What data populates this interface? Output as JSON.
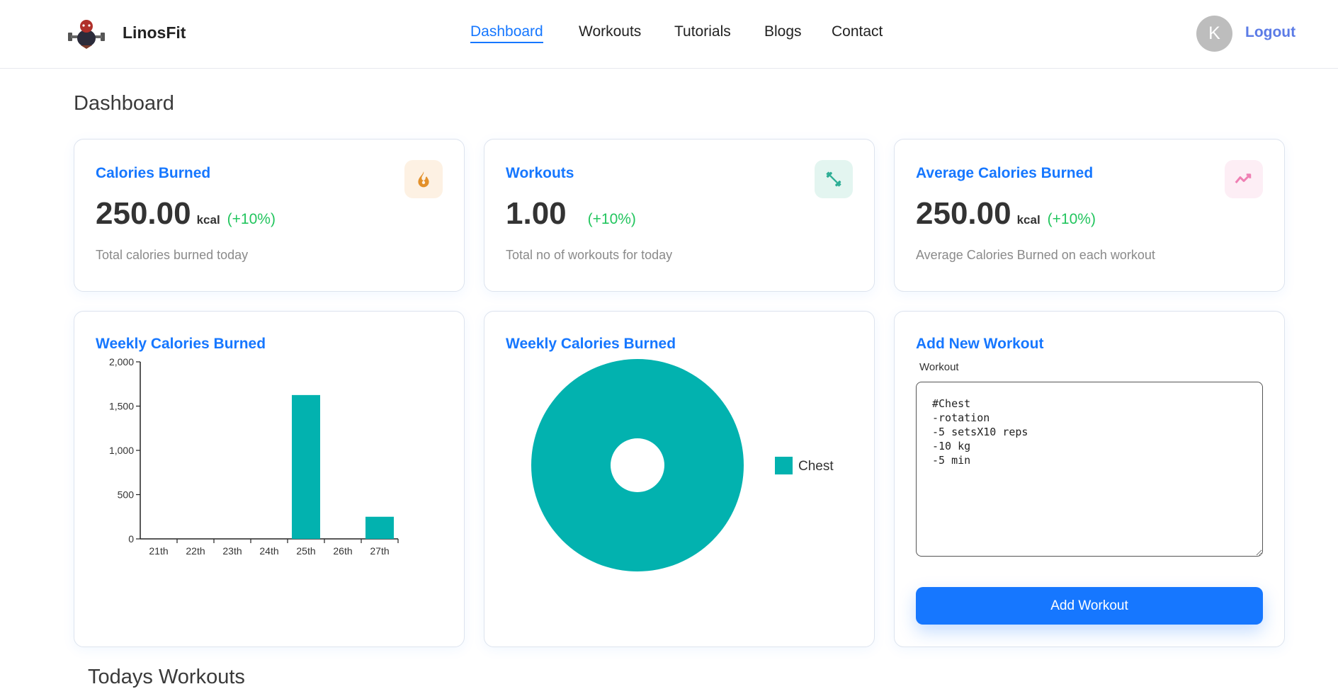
{
  "app": {
    "name": "LinosFit"
  },
  "nav": {
    "items": [
      "Dashboard",
      "Workouts",
      "Tutorials",
      "Blogs",
      "Contact"
    ],
    "active": "Dashboard"
  },
  "user": {
    "avatar_initial": "K",
    "logout_label": "Logout"
  },
  "page": {
    "title": "Dashboard"
  },
  "stats": [
    {
      "title": "Calories Burned",
      "value": "250.00",
      "unit": "kcal",
      "change": "(+10%)",
      "description": "Total calories burned today",
      "icon": "fire-icon",
      "icon_color": "#e3902a",
      "icon_bg": "#fdf1e3"
    },
    {
      "title": "Workouts",
      "value": "1.00",
      "unit": "",
      "change": "(+10%)",
      "description": "Total no of workouts for today",
      "icon": "dumbbell-icon",
      "icon_color": "#2eae95",
      "icon_bg": "#e3f5f0"
    },
    {
      "title": "Average Calories Burned",
      "value": "250.00",
      "unit": "kcal",
      "change": "(+10%)",
      "description": "Average Calories Burned on each workout",
      "icon": "trending-up-icon",
      "icon_color": "#ef7fb3",
      "icon_bg": "#fdeef5"
    }
  ],
  "colors": {
    "accent": "#1677ff",
    "positive": "#22c55e",
    "chart": "#02b2af"
  },
  "bar_card": {
    "title": "Weekly Calories Burned"
  },
  "pie_card": {
    "title": "Weekly Calories Burned"
  },
  "chart_data": [
    {
      "type": "bar",
      "title": "Weekly Calories Burned",
      "categories": [
        "21th",
        "22th",
        "23th",
        "24th",
        "25th",
        "26th",
        "27th"
      ],
      "values": [
        0,
        0,
        0,
        0,
        1625,
        0,
        250
      ],
      "ylim": [
        0,
        2000
      ],
      "yticks": [
        0,
        500,
        1000,
        1500,
        2000
      ],
      "ytick_labels": [
        "0",
        "500",
        "1,000",
        "1,500",
        "2,000"
      ],
      "xlabel": "",
      "ylabel": "",
      "grid": false
    },
    {
      "type": "pie",
      "title": "Weekly Calories Burned",
      "donut": true,
      "slices": [
        {
          "label": "Chest",
          "value": 100
        }
      ],
      "legend": "right"
    }
  ],
  "add_workout": {
    "title": "Add New Workout",
    "field_label": "Workout",
    "field_value": "#Chest\n-rotation\n-5 setsX10 reps\n-10 kg\n-5 min",
    "button_label": "Add Workout"
  },
  "todays_workouts": {
    "title": "Todays Workouts"
  }
}
